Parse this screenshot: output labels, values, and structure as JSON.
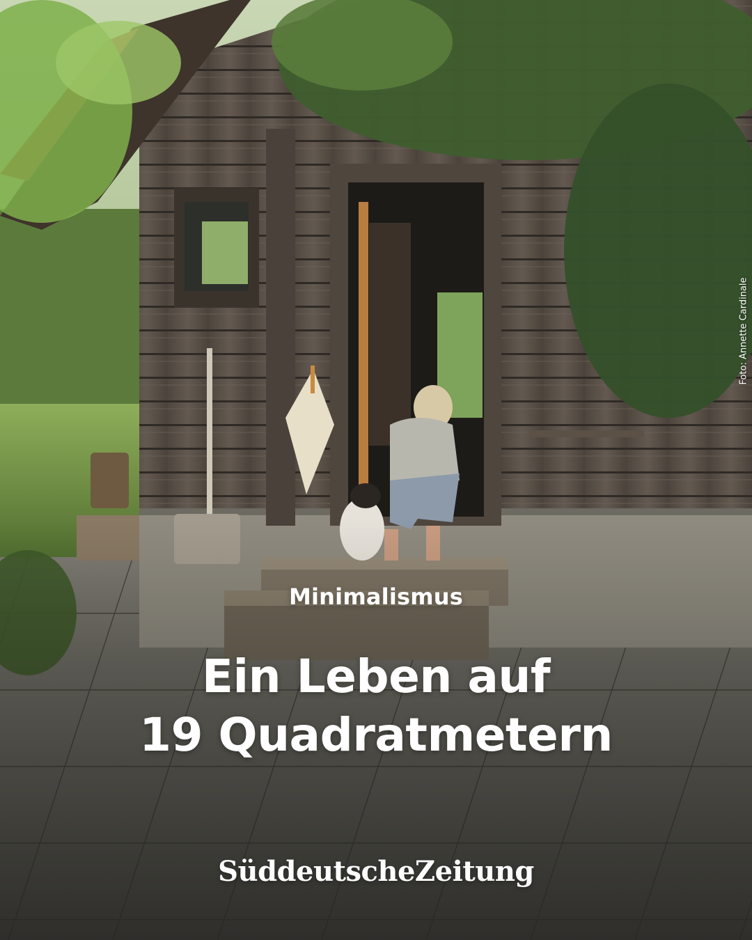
{
  "kicker": "Minimalismus",
  "headline": {
    "line1": "Ein Leben auf",
    "line2": "19 Quadratmetern"
  },
  "brand": "SüddeutscheZeitung",
  "photo_credit": "Foto: Annette Cardinale",
  "colors": {
    "text": "#ffffff",
    "wood": "#5a5046",
    "foliage": "#3f5e2e",
    "paving": "#6e6c64"
  }
}
